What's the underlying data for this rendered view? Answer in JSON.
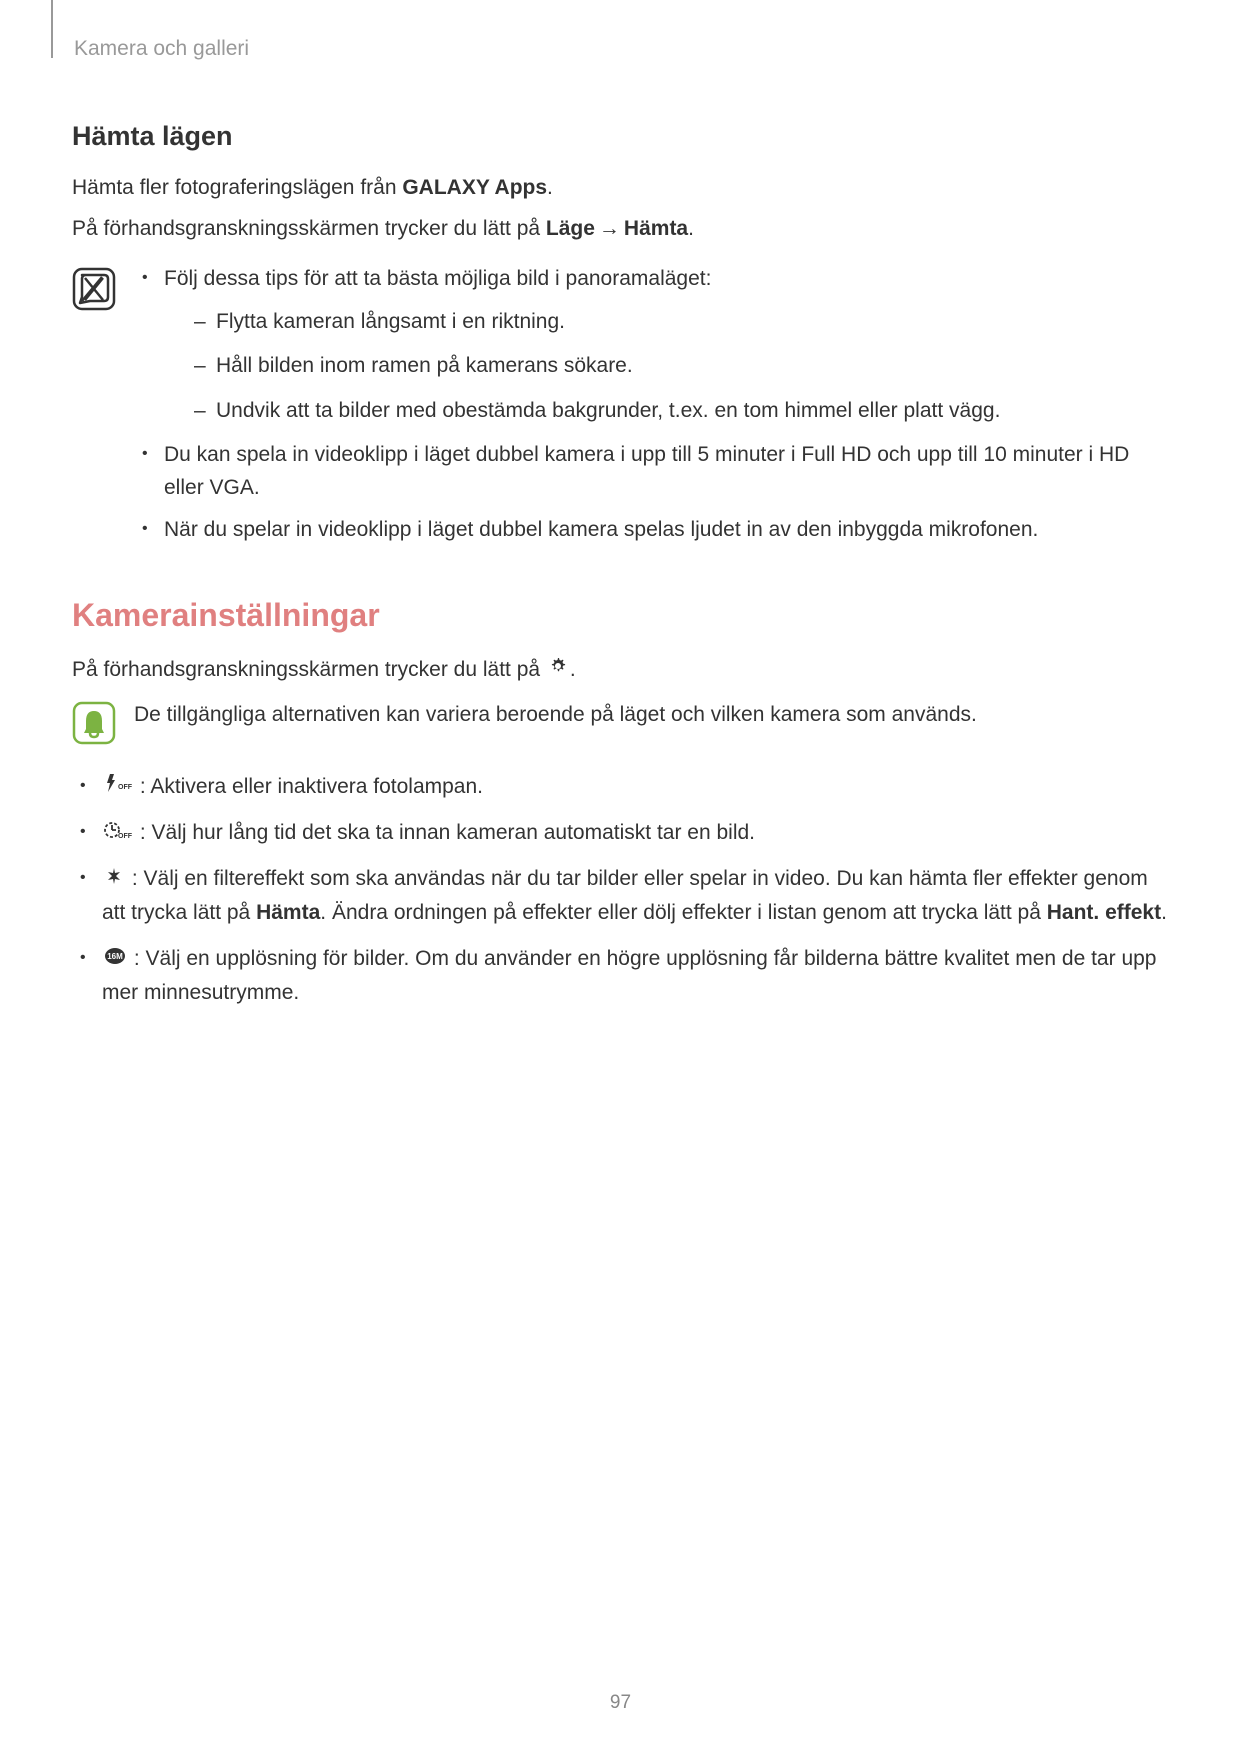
{
  "header": "Kamera och galleri",
  "section1": {
    "title": "Hämta lägen",
    "intro_part1": "Hämta fler fotograferingslägen från ",
    "intro_bold1": "GALAXY Apps",
    "intro_part2": ".",
    "instruction_part1": "På förhandsgranskningsskärmen trycker du lätt på ",
    "instruction_bold1": "Läge",
    "instruction_arrow": " → ",
    "instruction_bold2": "Hämta",
    "instruction_part2": "."
  },
  "note": {
    "tip_intro": "Följ dessa tips för att ta bästa möjliga bild i panoramaläget:",
    "tip_a": "Flytta kameran långsamt i en riktning.",
    "tip_b": "Håll bilden inom ramen på kamerans sökare.",
    "tip_c": "Undvik att ta bilder med obestämda bakgrunder, t.ex. en tom himmel eller platt vägg.",
    "bullet2": "Du kan spela in videoklipp i läget dubbel kamera i upp till 5 minuter i Full HD och upp till 10 minuter i HD eller VGA.",
    "bullet3": "När du spelar in videoklipp i läget dubbel kamera spelas ljudet in av den inbyggda mikrofonen."
  },
  "section2": {
    "title": "Kamerainställningar",
    "intro_part1": "På förhandsgranskningsskärmen trycker du lätt på ",
    "intro_part2": "."
  },
  "info": {
    "text": "De tillgängliga alternativen kan variera beroende på läget och vilken kamera som används."
  },
  "settings": {
    "item1": " : Aktivera eller inaktivera fotolampan.",
    "item2": " : Välj hur lång tid det ska ta innan kameran automatiskt tar en bild.",
    "item3_a": " : Välj en filtereffekt som ska användas när du tar bilder eller spelar in video. Du kan hämta fler effekter genom att trycka lätt på ",
    "item3_bold1": "Hämta",
    "item3_b": ". Ändra ordningen på effekter eller dölj effekter i listan genom att trycka lätt på ",
    "item3_bold2": "Hant. effekt",
    "item3_c": ".",
    "item4": " : Välj en upplösning för bilder. Om du använder en högre upplösning får bilderna bättre kvalitet men de tar upp mer minnesutrymme."
  },
  "pageNumber": "97"
}
